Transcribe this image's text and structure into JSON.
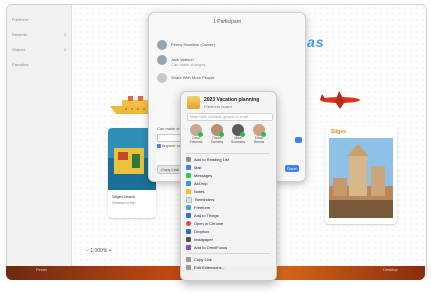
{
  "sidebar": {
    "items": [
      {
        "label": "Freeform",
        "count": ""
      },
      {
        "label": "Recents",
        "count": "3"
      },
      {
        "label": "Shared",
        "count": "2"
      },
      {
        "label": "Favorites",
        "count": ""
      }
    ]
  },
  "canvas": {
    "heading": "as",
    "sitges_title": "Sitges",
    "card_left_caption": "Sitges beach",
    "card_left_subcaption": "Weekend trip",
    "zoom_label": "1,000%"
  },
  "dock": {
    "left_label": "Finder",
    "right_label": "Desktop"
  },
  "participants": {
    "title": "1 Participant",
    "people": [
      {
        "name": "Penny Hamilton (Owner)"
      },
      {
        "name": "Jack Watson",
        "sub": "Can make changes"
      },
      {
        "name": "Share With More People"
      }
    ],
    "permissions_label": "Can make changes",
    "anyone_label": "Anyone can add people",
    "copy_button": "Copy Link",
    "done_button": "Done"
  },
  "share_menu": {
    "title": "2023 Vacation planning",
    "subtitle": "Freeform board",
    "field_placeholder": "Share with contacts, groups or email",
    "contacts": [
      {
        "name": "Carol Edwards",
        "color": "#c8a890"
      },
      {
        "name": "Daniel Sanders",
        "color": "#b89070"
      },
      {
        "name": "Mike Sommers",
        "color": "#5a5a5a"
      },
      {
        "name": "Ethan Ramos",
        "color": "#d0a080"
      }
    ],
    "items": [
      {
        "label": "Add to Reading List",
        "icon": "reading-list-icon",
        "color": "#8e8e93"
      },
      {
        "label": "Mail",
        "icon": "mail-icon",
        "color": "#3b82f6"
      },
      {
        "label": "Messages",
        "icon": "messages-icon",
        "color": "#34c759"
      },
      {
        "label": "AirDrop",
        "icon": "airdrop-icon",
        "color": "#2f9ae0"
      },
      {
        "label": "Notes",
        "icon": "notes-icon",
        "color": "#f5c21b"
      },
      {
        "label": "Reminders",
        "icon": "reminders-icon",
        "color": "#e0e0e0"
      },
      {
        "label": "Freeform",
        "icon": "freeform-icon",
        "color": "#4aa0e0"
      },
      {
        "label": "Add to Things",
        "icon": "things-icon",
        "color": "#2f6fe0"
      },
      {
        "label": "Open in Chrome",
        "icon": "chrome-icon",
        "color": "#e04a3a"
      },
      {
        "label": "Dropbox",
        "icon": "dropbox-icon",
        "color": "#3464e0"
      },
      {
        "label": "Instapaper",
        "icon": "instapaper-icon",
        "color": "#555555"
      },
      {
        "label": "Add to OmniFocus",
        "icon": "omnifocus-icon",
        "color": "#7a4fd0"
      }
    ],
    "footer_items": [
      {
        "label": "Copy Link",
        "icon": "link-icon",
        "color": "#9a9a9a"
      },
      {
        "label": "Edit Extensions…",
        "icon": "extensions-icon",
        "color": "#9a9a9a"
      }
    ]
  }
}
